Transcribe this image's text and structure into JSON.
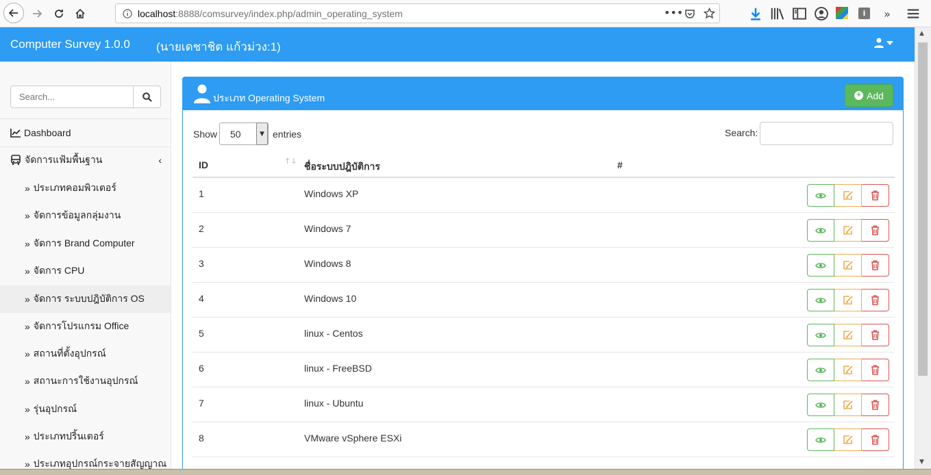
{
  "browser": {
    "url_prefix": "localhost",
    "url_rest": ":8888/comsurvey/index.php/admin_operating_system"
  },
  "header": {
    "title": "Computer Survey 1.0.0",
    "user": "(นายเดชาชิต แก้วม่วง:1)"
  },
  "sidebar": {
    "search_placeholder": "Search...",
    "dashboard_label": "Dashboard",
    "section_label": "จัดการแฟ้มพื้นฐาน",
    "items": [
      {
        "label": "ประเภทคอมพิวเตอร์"
      },
      {
        "label": "จัดการข้อมูลกลุ่มงาน"
      },
      {
        "label": "จัดการ Brand Computer"
      },
      {
        "label": "จัดการ CPU"
      },
      {
        "label": "จัดการ ระบบปฎิบัติการ OS"
      },
      {
        "label": "จัดการโปรแกรม Office"
      },
      {
        "label": "สถานที่ตั้งอุปกรณ์"
      },
      {
        "label": "สถานะการใช้งานอุปกรณ์"
      },
      {
        "label": "รุ่นอุปกรณ์"
      },
      {
        "label": "ประเภทปริ้นเตอร์"
      },
      {
        "label": "ประเภทอุปกรณ์กระจายสัญญาณ"
      }
    ]
  },
  "panel": {
    "title": "ประเภท Operating System",
    "add_label": "Add",
    "show_label": "Show",
    "entries_value": "50",
    "entries_label": "entries",
    "search_label": "Search:"
  },
  "table": {
    "columns": [
      "ID",
      "ชื่อระบบปฎิบัติการ",
      "#"
    ],
    "rows": [
      {
        "id": "1",
        "name": "Windows XP"
      },
      {
        "id": "2",
        "name": "Windows 7"
      },
      {
        "id": "3",
        "name": "Windows 8"
      },
      {
        "id": "4",
        "name": "Windows 10"
      },
      {
        "id": "5",
        "name": "linux - Centos"
      },
      {
        "id": "6",
        "name": "linux - FreeBSD"
      },
      {
        "id": "7",
        "name": "linux - Ubuntu"
      },
      {
        "id": "8",
        "name": "VMware vSphere ESXi"
      }
    ]
  },
  "colors": {
    "primary": "#2d9cf2",
    "success": "#5cb85c",
    "warning": "#f0ad4e",
    "danger": "#d9534f"
  }
}
